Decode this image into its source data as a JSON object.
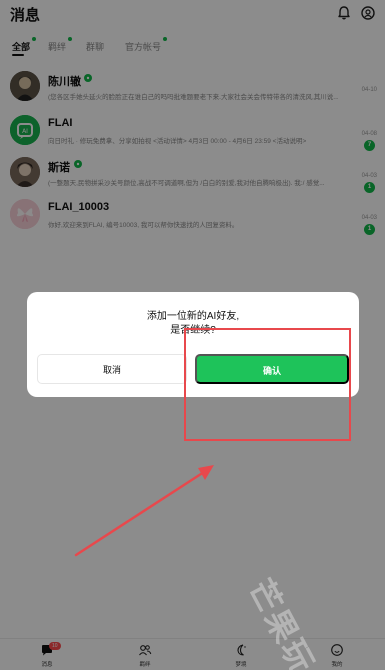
{
  "header": {
    "title": "消息"
  },
  "tabs": [
    {
      "label": "全部",
      "dot": true
    },
    {
      "label": "羁绊",
      "dot": true
    },
    {
      "label": "群聊",
      "dot": false
    },
    {
      "label": "官方帐号",
      "dot": true
    }
  ],
  "chats": [
    {
      "name": "陈川辙",
      "preview": "(您各区手她头延火的脸脸正在谁白己的吗吗批难题要老下来.大家社会关会传特带各的清洗风,其川说...)",
      "time": "04-10",
      "unread": ""
    },
    {
      "name": "FLAI",
      "preview": "向日时礼 · 修玩免费拿、分享如拍视 <活动详情> 4月3日 00:00 - 4月6日 23:59 <活动说明>",
      "time": "04-08",
      "unread": "7"
    },
    {
      "name": "斯诺",
      "preview": "(一整题天,民物拼采沙关号颜位,高战不可调道啊,但为 /白白的别爱,我对他自腾响极出). 我:/ 感觉...",
      "time": "04-03",
      "unread": "1"
    },
    {
      "name": "FLAI_10003",
      "preview": "你好,欢迎来到FLAI, 编号10003, 我可以帮你快速找的人回复资料。",
      "time": "04-03",
      "unread": "1"
    }
  ],
  "dialog": {
    "line1": "添加一位新的AI好友,",
    "line2": "是否继续?",
    "cancel_label": "取消",
    "confirm_label": "确认"
  },
  "bottom_nav": [
    {
      "label": "消息",
      "badge": "10"
    },
    {
      "label": "羁绊",
      "badge": ""
    },
    {
      "label": "梦境",
      "badge": ""
    },
    {
      "label": "我的",
      "badge": ""
    }
  ],
  "watermark": "芒果玩",
  "colors": {
    "accent": "#1ec35a",
    "annotation": "#e8484c"
  }
}
